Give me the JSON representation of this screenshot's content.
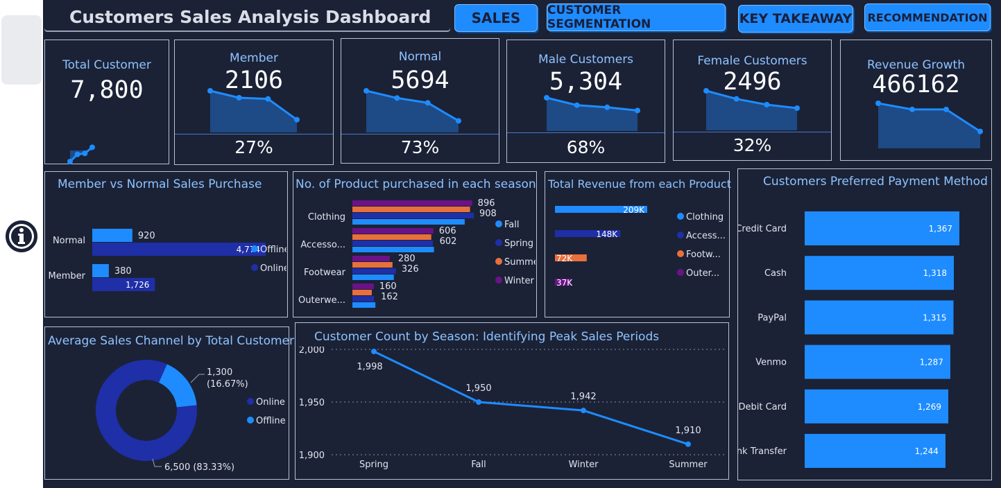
{
  "header": {
    "title": "Customers Sales Analysis Dashboard",
    "nav": [
      {
        "label": "SALES"
      },
      {
        "label": "CUSTOMER SEGMENTATION"
      },
      {
        "label": "KEY TAKEAWAY"
      },
      {
        "label": "RECOMMENDATION"
      }
    ]
  },
  "kpis": [
    {
      "label": "Total Customer",
      "value": "7,800",
      "pct": "",
      "trend": [
        4,
        2.6,
        2.4,
        1.2
      ]
    },
    {
      "label": "Member",
      "value": "2106",
      "pct": "27%",
      "trend": [
        4,
        3.4,
        3.3,
        1.5
      ]
    },
    {
      "label": "Normal",
      "value": "5694",
      "pct": "73%",
      "trend": [
        4,
        3.4,
        3.0,
        1.5
      ]
    },
    {
      "label": "Male Customers",
      "value": "5,304",
      "pct": "68%",
      "trend": [
        4,
        3.3,
        3.1,
        2.8
      ]
    },
    {
      "label": "Female Customers",
      "value": "2496",
      "pct": "32%",
      "trend": [
        4,
        3.3,
        2.8,
        2.5
      ]
    },
    {
      "label": "Revenue Growth",
      "value": "466162",
      "pct": "",
      "trend": [
        4,
        3.5,
        3.5,
        1.7
      ]
    }
  ],
  "colors": {
    "background": "#1b2236",
    "accent": "#1e8cff",
    "online": "#1f2fa8",
    "offline": "#1e8cff",
    "fall": "#1e8cff",
    "spring": "#1f2fa8",
    "summer": "#e8703c",
    "winter": "#6b1288"
  },
  "chart_data": [
    {
      "id": "member_vs_normal",
      "type": "bar",
      "orientation": "horizontal",
      "title": "Member vs Normal Sales Purchase",
      "categories": [
        "Normal",
        "Member"
      ],
      "series": [
        {
          "name": "Offline",
          "values": [
            920,
            380
          ]
        },
        {
          "name": "Online",
          "values": [
            4774,
            1726
          ]
        }
      ],
      "value_labels": [
        [
          "920",
          "380"
        ],
        [
          "4,774",
          "1,726"
        ]
      ],
      "legend": "right"
    },
    {
      "id": "season_products",
      "type": "bar",
      "orientation": "horizontal",
      "title": "No. of Product purchased in each season",
      "categories": [
        "Clothing",
        "Accesso...",
        "Footwear",
        "Outerwe..."
      ],
      "series": [
        {
          "name": "Winter",
          "values": [
            896,
            606,
            280,
            160
          ]
        },
        {
          "name": "Summer",
          "values": [
            880,
            590,
            300,
            145
          ]
        },
        {
          "name": "Spring",
          "values": [
            908,
            602,
            326,
            162
          ]
        },
        {
          "name": "Fall",
          "values": [
            840,
            610,
            310,
            172
          ]
        }
      ],
      "labelled": [
        [
          "896",
          "606",
          "280",
          "160"
        ],
        [
          "908",
          "602",
          "326",
          "162"
        ]
      ],
      "legend": "right"
    },
    {
      "id": "revenue_product",
      "type": "bar",
      "orientation": "horizontal",
      "title": "Total Revenue from each Product",
      "categories": [
        "Clothing",
        "Access...",
        "Footw...",
        "Outer..."
      ],
      "values": [
        209,
        148,
        72,
        37
      ],
      "value_labels": [
        "209K",
        "148K",
        "72K",
        "37K"
      ],
      "legend": "right"
    },
    {
      "id": "payment",
      "type": "bar",
      "orientation": "horizontal",
      "title": "Customers Preferred Payment Method",
      "categories": [
        "Credit Card",
        "Cash",
        "PayPal",
        "Venmo",
        "Debit Card",
        "Bank Transfer"
      ],
      "values": [
        1367,
        1318,
        1315,
        1287,
        1269,
        1244
      ],
      "value_labels": [
        "1,367",
        "1,318",
        "1,315",
        "1,287",
        "1,269",
        "1,244"
      ]
    },
    {
      "id": "channel_donut",
      "type": "pie",
      "title": "Average Sales Channel by Total Customers",
      "slices": [
        {
          "name": "Online",
          "value": 6500,
          "label": "6,500 (83.33%)"
        },
        {
          "name": "Offline",
          "value": 1300,
          "label_value": "1,300",
          "label_pct": "(16.67%)"
        }
      ],
      "legend": "right"
    },
    {
      "id": "season_customers",
      "type": "line",
      "title": "Customer Count by Season: Identifying Peak Sales Periods",
      "x": [
        "Spring",
        "Fall",
        "Winter",
        "Summer"
      ],
      "y": [
        1998,
        1950,
        1942,
        1910
      ],
      "value_labels": [
        "1,998",
        "1,950",
        "1,942",
        "1,910"
      ],
      "ylim": [
        1900,
        2000
      ],
      "yticks": [
        "2,000",
        "1,950",
        "1,900"
      ],
      "grid": true
    }
  ]
}
